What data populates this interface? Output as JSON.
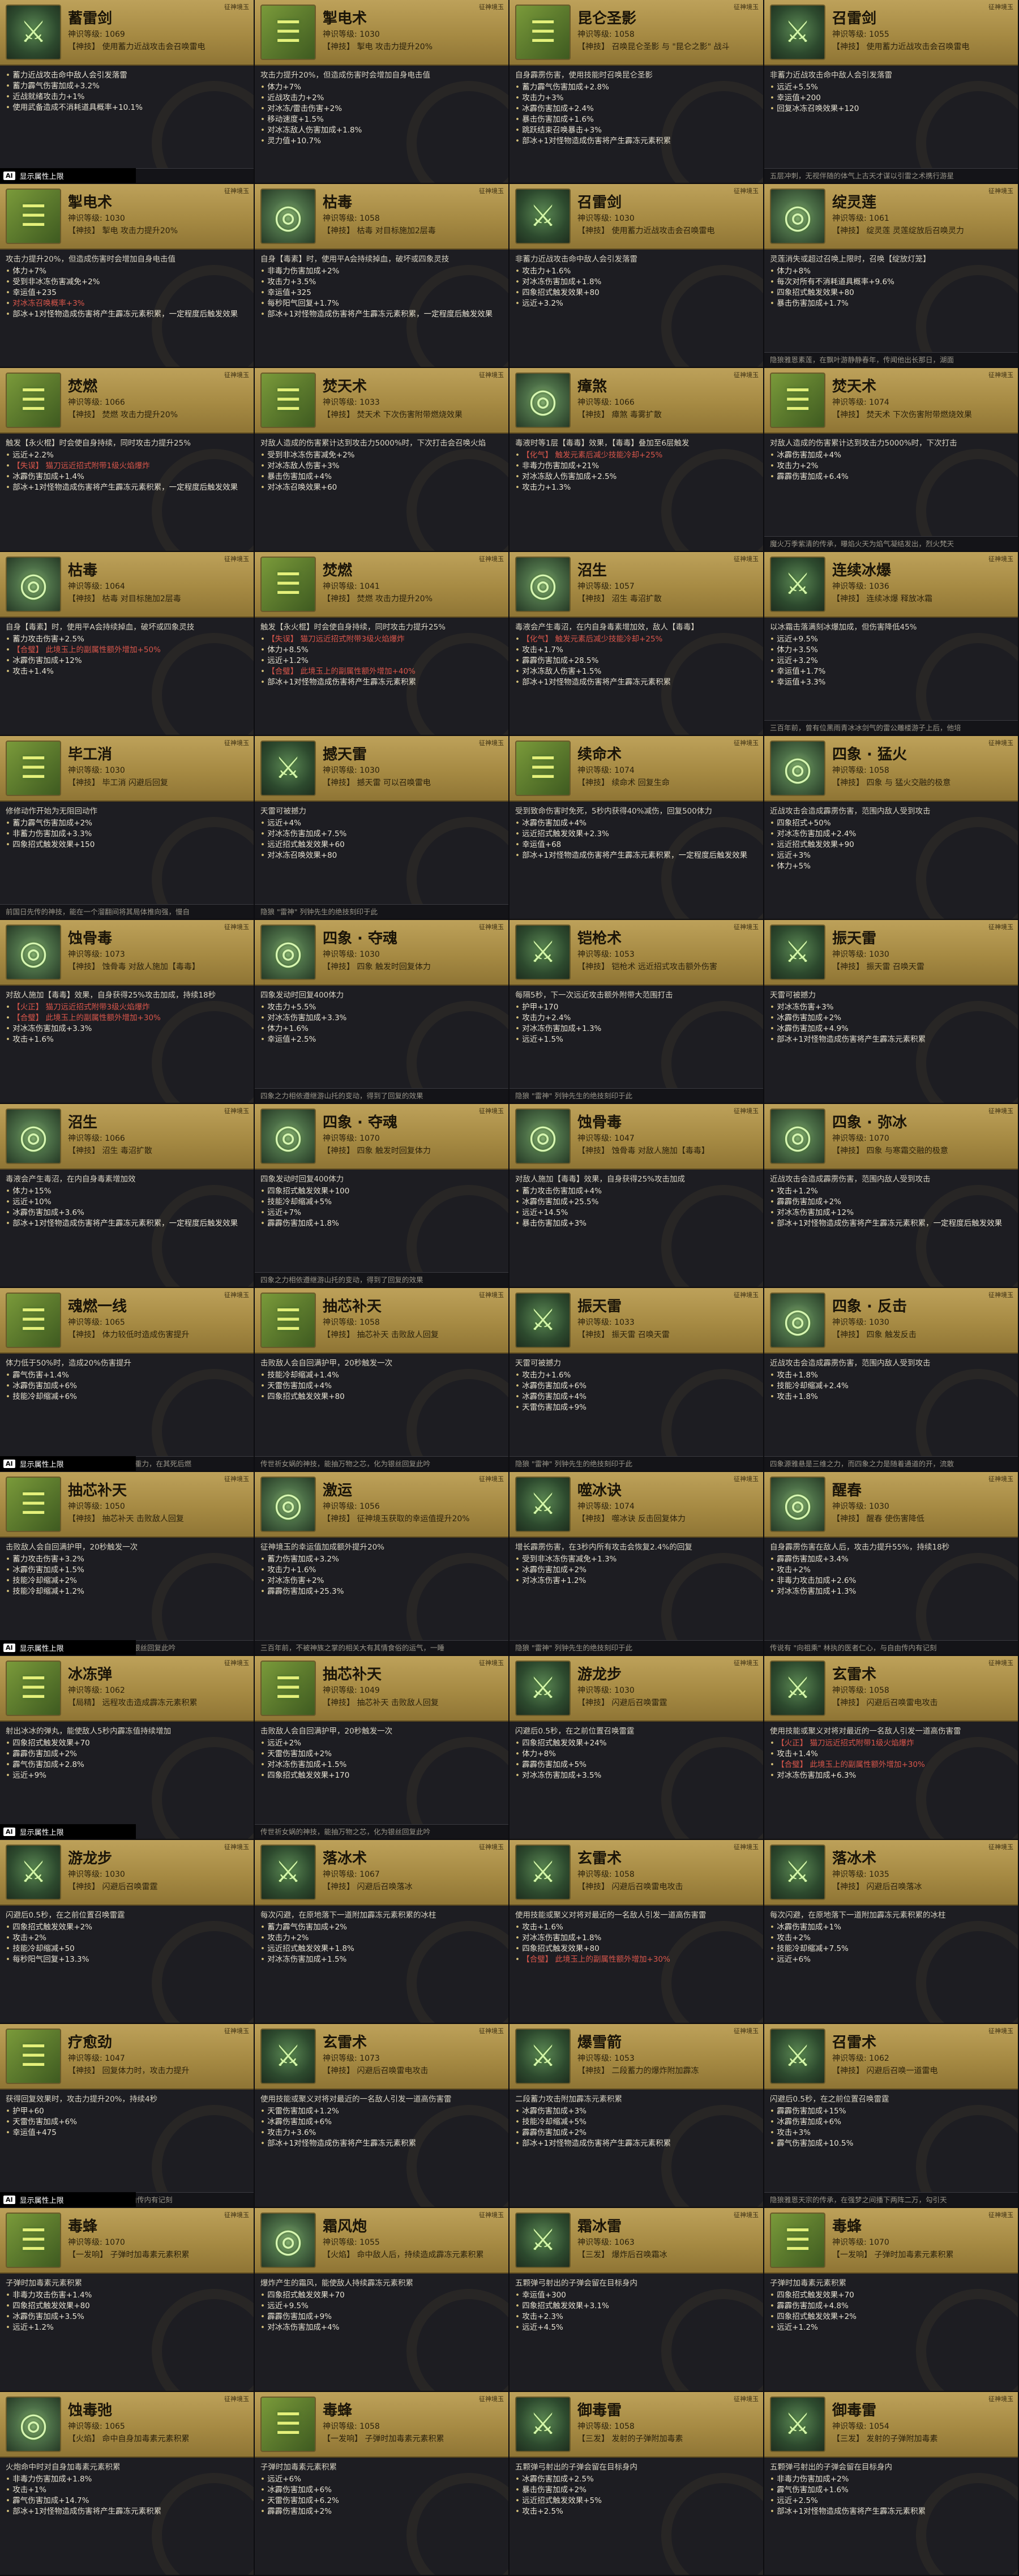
{
  "badge_label": "征神境玉",
  "ai_tag": "AI",
  "ai_text": "显示属性上限",
  "cards": [
    {
      "title": "蓄雷剑",
      "level": "神识等级: 1069",
      "effect": "【神技】 使用蓄力近战攻击会召唤雷电",
      "icon": "sword",
      "desc": "",
      "stats": [
        "蓄力近战攻击命中敌人会引发落雷",
        "蓄力霹气伤害加成+3.2%",
        "近战就绪攻击力+1%",
        "使用武备造成不消耗道具概率+10.1%"
      ],
      "foot": "隐狼 \"雷神\" 列钟先生的绝技刻印于此",
      "ai": true
    },
    {
      "title": "掣电术",
      "level": "神识等级: 1030",
      "effect": "【神技】 掣电 攻击力提升20%",
      "icon": "book",
      "desc": "攻击力提升20%，但造成伤害时会增加自身电击值",
      "stats": [
        "体力+7%",
        "近战攻击力+2%",
        "对冰冻/雷击伤害+2%",
        "移动速度+1.5%",
        "对冰冻敌人伤害加成+1.8%",
        "灵力值+10.7%"
      ],
      "foot": ""
    },
    {
      "title": "昆仑圣影",
      "level": "神识等级: 1058",
      "effect": "【神技】 召唤昆仑圣影 与 \"昆仑之影\" 战斗",
      "icon": "book",
      "desc": "自身霹雳伤害，使用技能时召唤昆仑圣影",
      "stats": [
        "蓄力霹气伤害加成+2.8%",
        "攻击力+3%",
        "冰霹伤害加成+2.4%",
        "暴击伤害加成+1.6%",
        "跳跃结束召唤暴击+3%",
        "部冰+1对怪物造成伤害将产生霹冻元素积累"
      ],
      "foot": ""
    },
    {
      "title": "召雷剑",
      "level": "神识等级: 1055",
      "effect": "【神技】 使用蓄力近战攻击会召唤雷电",
      "icon": "sword",
      "desc": "非蓄力近战攻击命中敌人会引发落雷",
      "stats": [
        "远近+5.5%",
        "幸运值+200",
        "回复冰冻召唤效果+120"
      ],
      "foot": "五层冲刺，无视伴随的体气上古天才谋以引雷之术携行游星"
    },
    {
      "title": "掣电术",
      "level": "神识等级: 1030",
      "effect": "【神技】 掣电 攻击力提升20%",
      "icon": "book",
      "desc": "攻击力提升20%，但造成伤害时会增加自身电击值",
      "stats": [
        "体力+7%",
        "受到非冰冻伤害减免+2%",
        "幸运值+235",
        "对冰冻召唤概率+3%",
        "部冰+1对怪物造成伤害将产生霹冻元素积累，一定程度后触发效果"
      ],
      "foot": "",
      "hl": [
        3
      ]
    },
    {
      "title": "枯毒",
      "level": "神识等级: 1058",
      "effect": "【神技】 枯毒 对目标施加2层毒",
      "icon": "disc",
      "desc": "自身【毒素】时，使用平A会持续掉血，破坏或四象灵技",
      "stats": [
        "非毒力伤害加成+2%",
        "攻击力+3.5%",
        "幸运值+325",
        "每秒阳气回复+1.7%",
        "部冰+1对怪物造成伤害将产生霹冻元素积累，一定程度后触发效果"
      ],
      "foot": ""
    },
    {
      "title": "召雷剑",
      "level": "神识等级: 1030",
      "effect": "【神技】 使用蓄力近战攻击会召唤雷电",
      "icon": "sword",
      "desc": "非蓄力近战攻击命中敌人会引发落雷",
      "stats": [
        "攻击力+1.6%",
        "对冰冻伤害加成+1.8%",
        "四象招式触发效果+80",
        "远近+3.2%"
      ],
      "foot": ""
    },
    {
      "title": "绽灵莲",
      "level": "神识等级: 1061",
      "effect": "【神技】 绽灵莲 灵莲绽放后召唤灵力",
      "icon": "disc",
      "desc": "灵莲消失或超过召唤上限时，召唤【绽放灯笼】",
      "stats": [
        "体力+8%",
        "每次对所有不消耗道具概率+9.6%",
        "四象招式触发效果+80",
        "暴击伤害加成+1.7%"
      ],
      "foot": "隐狼雅恩素莲，在飘叶游静静春年，传闻他出长那日，湖面"
    },
    {
      "title": "焚燃",
      "level": "神识等级: 1066",
      "effect": "【神技】 焚燃 攻击力提升20%",
      "icon": "book",
      "desc": "触发【永火棍】时会使自身持续，同时攻击力提升25%",
      "stats": [
        "远近+2.2%",
        "【失误】 猫刀远近招式附带1级火焰爆炸",
        "冰霹伤害加成+1.4%",
        "部冰+1对怪物造成伤害将产生霹冻元素积累，一定程度后触发效果"
      ],
      "foot": "",
      "hl": [
        1
      ]
    },
    {
      "title": "焚天术",
      "level": "神识等级: 1033",
      "effect": "【神技】 焚天术 下次伤害附带燃烧效果",
      "icon": "book",
      "desc": "对敌人造成的伤害累计达到攻击力5000%时，下次打击会召唤火焰",
      "stats": [
        "受到非冰冻伤害减免+2%",
        "对冰冻敌人伤害+3%",
        "暴击伤害加成+4%",
        "对冰冻召唤效果+60"
      ],
      "foot": ""
    },
    {
      "title": "瘴煞",
      "level": "神识等级: 1066",
      "effect": "【神技】 瘴煞 毒雾扩散",
      "icon": "disc",
      "desc": "毒液时等1层【毒毒】效果，【毒毒】叠加至6层触发",
      "stats": [
        "【化气】 触发元素后减少技能冷却+25%",
        "非毒力伤害加成+21%",
        "对冰冻敌人伤害加成+2.5%",
        "攻击力+1.3%"
      ],
      "foot": "",
      "hl": [
        0
      ]
    },
    {
      "title": "焚天术",
      "level": "神识等级: 1074",
      "effect": "【神技】 焚天术 下次伤害附带燃烧效果",
      "icon": "book",
      "desc": "对敌人造成的伤害累计达到攻击力5000%时，下次打击",
      "stats": [
        "冰霹伤害加成+4%",
        "攻击力+2%",
        "霹霹伤害加成+6.4%"
      ],
      "foot": "魔火万季紫清的传承，曝焰火天为焰气凝结发出，烈火梵天"
    },
    {
      "title": "枯毒",
      "level": "神识等级: 1064",
      "effect": "【神技】 枯毒 对目标施加2层毒",
      "icon": "disc",
      "desc": "自身【毒素】时，使用平A会持续掉血，破坏或四象灵技",
      "stats": [
        "蓄力攻击伤害+2.5%",
        "【合璧】 此境玉上的副属性额外增加+50%",
        "冰霹伤害加成+12%",
        "攻击+1.4%"
      ],
      "foot": "",
      "hl": [
        1
      ]
    },
    {
      "title": "焚燃",
      "level": "神识等级: 1041",
      "effect": "【神技】 焚燃 攻击力提升20%",
      "icon": "book",
      "desc": "触发【永火棍】时会使自身持续，同时攻击力提升25%",
      "stats": [
        "【失误】 猫刀远近招式附带3级火焰爆炸",
        "体力+8.5%",
        "远近+1.2%",
        "【合璧】 此境玉上的副属性额外增加+40%",
        "部冰+1对怪物造成伤害将产生霹冻元素积累"
      ],
      "foot": "",
      "hl": [
        0,
        3
      ]
    },
    {
      "title": "沼生",
      "level": "神识等级: 1057",
      "effect": "【神技】 沼生 毒沼扩散",
      "icon": "disc",
      "desc": "毒液会产生毒沼，在内自身毒素增加效，敌人【毒毒】",
      "stats": [
        "【化气】 触发元素后减少技能冷却+25%",
        "攻击+1.7%",
        "霹霹伤害加成+28.5%",
        "对冰冻敌人伤害+1.5%",
        "部冰+1对怪物造成伤害将产生霹冻元素积累"
      ],
      "foot": "",
      "hl": [
        0
      ]
    },
    {
      "title": "连续冰爆",
      "level": "神识等级: 1036",
      "effect": "【神技】 连续冰爆 释放冰霜",
      "icon": "sword",
      "desc": "以冰霜击落满刻冰爆加成，但伤害降低45%",
      "stats": [
        "远近+9.5%",
        "体力+3.5%",
        "远近+3.2%",
        "幸运值+1.7%",
        "幸运值+3.3%"
      ],
      "foot": "三百年前，曾有位黑雨青冰冰剑气的雷公雕楼游子上后，他培"
    },
    {
      "title": "毕工消",
      "level": "神识等级: 1030",
      "effect": "【神技】 毕工消 闪避后回复",
      "icon": "book",
      "desc": "修修动作开始为无阻回动作",
      "stats": [
        "蓄力霹气伤害加成+2%",
        "非蓄力伤害加成+3.3%",
        "四象招式触发效果+150"
      ],
      "foot": "前国日先传的神技，能在一个溜翻间将其局体推向强，慢自"
    },
    {
      "title": "撼天雷",
      "level": "神识等级: 1030",
      "effect": "【神技】 撼天雷 可以召唤雷电",
      "icon": "sword",
      "desc": "天雷可被撼力",
      "stats": [
        "远近+4%",
        "对冰冻伤害加成+7.5%",
        "远近招式触发效果+60",
        "对冰冻召唤效果+80"
      ],
      "foot": "隐狼 \"雷神\" 列钟先生的绝技刻印于此"
    },
    {
      "title": "续命术",
      "level": "神识等级: 1074",
      "effect": "【神技】 续命术 回复生命",
      "icon": "book",
      "desc": "受到致命伤害时免死，5秒内获得40%减伤，回复500体力",
      "stats": [
        "冰霹伤害加成+4%",
        "远近招式触发效果+2.3%",
        "幸运值+68",
        "部冰+1对怪物造成伤害将产生霹冻元素积累，一定程度后触发效果"
      ],
      "foot": ""
    },
    {
      "title": "四象 · 猛火",
      "level": "神识等级: 1058",
      "effect": "【神技】 四象 与 猛火交融的极意",
      "icon": "disc",
      "desc": "近战攻击会造成霹雳伤害，范围内敌人受到攻击",
      "stats": [
        "四象招式+50%",
        "对冰冻伤害加成+2.4%",
        "远近招式触发效果+90",
        "远近+3%",
        "体力+5%"
      ],
      "foot": ""
    },
    {
      "title": "蚀骨毒",
      "level": "神识等级: 1073",
      "effect": "【神技】 蚀骨毒 对敌人施加【毒毒】",
      "icon": "disc",
      "desc": "对敌人施加【毒毒】效果，自身获得25%攻击加成，持续18秒",
      "stats": [
        "【火正】 猫刀远近招式附带3级火焰爆炸",
        "【合璧】 此境玉上的副属性额外增加+30%",
        "对冰冻伤害加成+3.3%",
        "攻击+1.6%"
      ],
      "foot": "",
      "hl": [
        0,
        1
      ]
    },
    {
      "title": "四象 · 夺魂",
      "level": "神识等级: 1030",
      "effect": "【神技】 四象 触发时回复体力",
      "icon": "disc",
      "desc": "四象发动时回复400体力",
      "stats": [
        "攻击力+5.5%",
        "对冰冻伤害加成+3.3%",
        "体力+1.6%",
        "幸运值+2.5%"
      ],
      "foot": "四象之力相依遵继游山托的变动，得到了回复的效果"
    },
    {
      "title": "铠枪术",
      "level": "神识等级: 1053",
      "effect": "【神技】 铠枪术 远近招式攻击额外伤害",
      "icon": "sword",
      "desc": "每隔5秒，下一次远近攻击额外附带大范围打击",
      "stats": [
        "护甲+170",
        "攻击力+2.4%",
        "对冰冻伤害加成+1.3%",
        "远近+1.5%"
      ],
      "foot": "隐狼 \"雷神\" 列钟先生的绝技刻印于此"
    },
    {
      "title": "振天雷",
      "level": "神识等级: 1030",
      "effect": "【神技】 振天雷 召唤天雷",
      "icon": "sword",
      "desc": "天雷可被撼力",
      "stats": [
        "对冰冻伤害+3%",
        "冰霹伤害加成+2%",
        "冰霹伤害加成+4.9%",
        "部冰+1对怪物造成伤害将产生霹冻元素积累"
      ],
      "foot": ""
    },
    {
      "title": "沼生",
      "level": "神识等级: 1066",
      "effect": "【神技】 沼生 毒沼扩散",
      "icon": "disc",
      "desc": "毒液会产生毒沼，在内自身毒素增加效",
      "stats": [
        "体力+15%",
        "远近+10%",
        "冰霹伤害加成+3.6%",
        "部冰+1对怪物造成伤害将产生霹冻元素积累，一定程度后触发效果"
      ],
      "foot": ""
    },
    {
      "title": "四象 · 夺魂",
      "level": "神识等级: 1070",
      "effect": "【神技】 四象 触发时回复体力",
      "icon": "disc",
      "desc": "四象发动时回复400体力",
      "stats": [
        "四象招式触发效果+100",
        "技能冷却缩减+5%",
        "远近+7%",
        "霹霹伤害加成+1.8%"
      ],
      "foot": "四象之力相依遵继游山托的变动，得到了回复的效果"
    },
    {
      "title": "蚀骨毒",
      "level": "神识等级: 1047",
      "effect": "【神技】 蚀骨毒 对敌人施加【毒毒】",
      "icon": "disc",
      "desc": "对敌人施加【毒毒】效果，自身获得25%攻击加成",
      "stats": [
        "蓄力攻击伤害加成+4%",
        "冰霹伤害加成+25.5%",
        "远近+14.5%",
        "暴击伤害加成+3%"
      ],
      "foot": ""
    },
    {
      "title": "四象 · 弥冰",
      "level": "神识等级: 1070",
      "effect": "【神技】 四象 与寒霜交融的极意",
      "icon": "disc",
      "desc": "近战攻击会造成霹雳伤害，范围内敌人受到攻击",
      "stats": [
        "攻击+1.2%",
        "霹霹伤害加成+2%",
        "对冰冻伤害加成+12%",
        "部冰+1对怪物造成伤害将产生霹冻元素积累，一定程度后触发效果"
      ],
      "foot": ""
    },
    {
      "title": "魂燃一线",
      "level": "神识等级: 1065",
      "effect": "【神技】 体力较低时造成伤害提升",
      "icon": "book",
      "desc": "体力低于50%时，造成20%伤害提升",
      "stats": [
        "霹气伤害+1.4%",
        "冰霹伤害加成+6%",
        "技能冷却缩减+6%"
      ],
      "foot": "\"魂灵燃\" 据说，能医者一线能毅然按照的重力，在其死后燃",
      "ai": true
    },
    {
      "title": "抽芯补天",
      "level": "神识等级: 1058",
      "effect": "【神技】 抽芯补天 击败敌人回复",
      "icon": "book",
      "desc": "击败敌人会自回满护甲，20秒触发一次",
      "stats": [
        "技能冷却缩减+1.4%",
        "天雷伤害加成+4%",
        "四象招式触发效果+80"
      ],
      "foot": "传世祈女娲的神技，能抽万物之芯，化为银丝回复此吟"
    },
    {
      "title": "振天雷",
      "level": "神识等级: 1033",
      "effect": "【神技】 振天雷 召唤天雷",
      "icon": "sword",
      "desc": "天雷可被撼力",
      "stats": [
        "攻击力+1.6%",
        "冰霹伤害加成+6%",
        "冰霹伤害加成+4%",
        "天雷伤害加成+9%"
      ],
      "foot": "隐狼 \"雷神\" 列钟先生的绝技刻印于此"
    },
    {
      "title": "四象 · 反击",
      "level": "神识等级: 1030",
      "effect": "【神技】 四象 触发反击",
      "icon": "disc",
      "desc": "近战攻击会造成霹雳伤害，范围内敌人受到攻击",
      "stats": [
        "攻击+1.8%",
        "技能冷却缩减+2.4%",
        "攻击+1.8%"
      ],
      "foot": "四象源雅悬是三维之力，而四象之力是随着通道的开，流散"
    },
    {
      "title": "抽芯补天",
      "level": "神识等级: 1050",
      "effect": "【神技】 抽芯补天 击败敌人回复",
      "icon": "book",
      "desc": "击败敌人会自回满护甲，20秒触发一次",
      "stats": [
        "蓄力攻击伤害+3.2%",
        "冰霹伤害加成+1.5%",
        "技能冷却缩减+2%",
        "技能冷却缩减+1.2%"
      ],
      "foot": "传世祈女娲的神技，能抽万物之芯，化为银丝回复此吟",
      "ai": true
    },
    {
      "title": "激运",
      "level": "神识等级: 1056",
      "effect": "【神技】 征神境玉获取的幸运值提升20%",
      "icon": "disc",
      "desc": "征神境玉的幸运值加成额外提升20%",
      "stats": [
        "蓄力伤害加成+3.2%",
        "攻击力+1.6%",
        "对冰冻伤害+2%",
        "霹霹伤害加成+25.3%"
      ],
      "foot": "三百年前，不被神族之掌的相关大有其情食俗的运气，一睡"
    },
    {
      "title": "噬冰诀",
      "level": "神识等级: 1074",
      "effect": "【神技】 噬冰诀 反击回复体力",
      "icon": "sword",
      "desc": "增长霹雳伤害，在3秒内所有攻击会恢复2.4%的回复",
      "stats": [
        "受到非冰冻伤害减免+1.3%",
        "冰霹伤害加成+2%",
        "对冰冻伤害+1.2%"
      ],
      "foot": "隐狼 \"雷神\" 列钟先生的绝技刻印于此"
    },
    {
      "title": "醒春",
      "level": "神识等级: 1030",
      "effect": "【神技】 醒春 使伤害降低",
      "icon": "disc",
      "desc": "自身霹雳伤害在敌人后，攻击力提升55%，持续18秒",
      "stats": [
        "霹霹伤害加成+3.4%",
        "攻击+2%",
        "非毒力攻击加成+2.6%",
        "对冰冻伤害加成+1.3%"
      ],
      "foot": "传说有 \"向祖乘\" 林执的医者仁心，与自由传内有记刻"
    },
    {
      "title": "冰冻弹",
      "level": "神识等级: 1062",
      "effect": "【局精】 远程攻击造成霹冻元素积累",
      "icon": "book",
      "desc": "射出冰冰的弹丸，能使敌人5秒内霹冻值持续增加",
      "stats": [
        "四象招式触发效果+70",
        "霹霹伤害加成+2%",
        "霹气伤害加成+2.8%",
        "远近+9%"
      ],
      "foot": "",
      "ai": true
    },
    {
      "title": "抽芯补天",
      "level": "神识等级: 1049",
      "effect": "【神技】 抽芯补天 击败敌人回复",
      "icon": "book",
      "desc": "击败敌人会自回满护甲，20秒触发一次",
      "stats": [
        "远近+2%",
        "天雷伤害加成+2%",
        "对冰冻伤害加成+1.5%",
        "四象招式触发效果+170"
      ],
      "foot": "传世祈女娲的神技，能抽万物之芯，化为银丝回复此吟"
    },
    {
      "title": "游龙步",
      "level": "神识等级: 1030",
      "effect": "【神技】 闪避后召唤雷霆",
      "icon": "sword",
      "desc": "闪避后0.5秒，在之前位置召唤雷霆",
      "stats": [
        "四象招式触发效果+24%",
        "体力+8%",
        "霹霹伤害加成+5%",
        "对冰冻伤害加成+3.5%"
      ],
      "foot": ""
    },
    {
      "title": "玄雷术",
      "level": "神识等级: 1058",
      "effect": "【神技】 闪避后召唤雷电攻击",
      "icon": "sword",
      "desc": "使用技能或聚义对将对最近的一名敌人引发一道高伤害雷",
      "stats": [
        "【火正】 猫刀远近招式附带1级火焰爆炸",
        "攻击+1.4%",
        "【合璧】 此境玉上的副属性额外增加+30%",
        "对冰冻伤害加成+6.3%"
      ],
      "foot": "",
      "hl": [
        0,
        2
      ]
    },
    {
      "title": "游龙步",
      "level": "神识等级: 1030",
      "effect": "【神技】 闪避后召唤雷霆",
      "icon": "sword",
      "desc": "闪避后0.5秒，在之前位置召唤雷霆",
      "stats": [
        "四象招式触发效果+2%",
        "攻击+2%",
        "技能冷却缩减+50",
        "每秒阳气回复+13.3%"
      ],
      "foot": ""
    },
    {
      "title": "落冰术",
      "level": "神识等级: 1067",
      "effect": "【神技】 闪避后召唤落冰",
      "icon": "sword",
      "desc": "每次闪避，在原地落下一道附加霹冻元素积累的冰柱",
      "stats": [
        "蓄力霹气伤害加成+2%",
        "攻击力+2%",
        "远近招式触发效果+1.8%",
        "对冰冻伤害加成+1.5%"
      ],
      "foot": ""
    },
    {
      "title": "玄雷术",
      "level": "神识等级: 1058",
      "effect": "【神技】 闪避后召唤雷电攻击",
      "icon": "sword",
      "desc": "使用技能或聚义对将对最近的一名敌人引发一道高伤害雷",
      "stats": [
        "攻击+1.6%",
        "对冰冻伤害加成+1.8%",
        "四象招式触发效果+80",
        "【合璧】 此境玉上的副属性额外增加+30%"
      ],
      "foot": "",
      "hl": [
        3
      ]
    },
    {
      "title": "落冰术",
      "level": "神识等级: 1035",
      "effect": "【神技】 闪避后召唤落冰",
      "icon": "sword",
      "desc": "每次闪避，在原地落下一道附加霹冻元素积累的冰柱",
      "stats": [
        "冰霹伤害加成+1%",
        "攻击+2%",
        "技能冷却缩减+7.5%",
        "远近+6%"
      ],
      "foot": ""
    },
    {
      "title": "疗愈劲",
      "level": "神识等级: 1047",
      "effect": "【神技】 回复体力时，攻击力提升",
      "icon": "book",
      "desc": "获得回复效果时，攻击力提升20%，持续4秒",
      "stats": [
        "护甲+60",
        "天雷伤害加成+6%",
        "幸运值+475"
      ],
      "foot": "刘存春 \"向祖乘\" 林执的医者仁心，与自由传内有记刻",
      "ai": true
    },
    {
      "title": "玄雷术",
      "level": "神识等级: 1073",
      "effect": "【神技】 闪避后召唤雷电攻击",
      "icon": "sword",
      "desc": "使用技能或聚义对将对最近的一名敌人引发一道高伤害雷",
      "stats": [
        "天雷伤害加成+1.2%",
        "冰霹伤害加成+6%",
        "攻击力+3.6%",
        "部冰+1对怪物造成伤害将产生霹冻元素积累"
      ],
      "foot": ""
    },
    {
      "title": "爆雪箭",
      "level": "神识等级: 1053",
      "effect": "【神技】 二段蓄力的爆炸附加霹冻",
      "icon": "sword",
      "desc": "二段蓄力攻击附加霹冻元素积累",
      "stats": [
        "冰霹伤害加成+3%",
        "技能冷却缩减+5%",
        "霹霹伤害加成+2%",
        "部冰+1对怪物造成伤害将产生霹冻元素积累"
      ],
      "foot": ""
    },
    {
      "title": "召雷术",
      "level": "神识等级: 1062",
      "effect": "【神技】 闪避后召唤一道雷电",
      "icon": "sword",
      "desc": "闪避后0.5秒，在之前位置召唤雷霆",
      "stats": [
        "霹霹伤害加成+15%",
        "冰霹伤害加成+6%",
        "攻击+3%",
        "霹气伤害加成+10.5%"
      ],
      "foot": "隐狼雅恩天宗的传承，在强梦之间播下两阵二万，勾引天"
    },
    {
      "title": "毒蜂",
      "level": "神识等级: 1070",
      "effect": "【一发响】 子弹时加毒素元素积累",
      "icon": "book",
      "desc": "子弹时加毒素元素积累",
      "stats": [
        "非毒力攻击伤害+1.4%",
        "四象招式触发效果+80",
        "冰霹伤害加成+3.5%",
        "远近+1.2%"
      ],
      "foot": ""
    },
    {
      "title": "霜风炮",
      "level": "神识等级: 1055",
      "effect": "【火焰】 命中敌人后，持续造成霹冻元素积累",
      "icon": "disc",
      "desc": "爆炸产生的霜风，能使敌人持续霹冻元素积累",
      "stats": [
        "四象招式触发效果+70",
        "远近+9.5%",
        "霹霹伤害加成+9%",
        "对冰冻伤害加成+4%"
      ],
      "foot": ""
    },
    {
      "title": "霜冰雷",
      "level": "神识等级: 1063",
      "effect": "【三发】 爆炸后召唤霜冰",
      "icon": "sword",
      "desc": "五颗弹弓射出的子弹会留在目标身内",
      "stats": [
        "幸运值+300",
        "四象招式触发效果+3.1%",
        "攻击+2.3%",
        "远近+4.5%"
      ],
      "foot": ""
    },
    {
      "title": "毒蜂",
      "level": "神识等级: 1070",
      "effect": "【一发响】 子弹时加毒素元素积累",
      "icon": "book",
      "desc": "子弹时加毒素元素积累",
      "stats": [
        "四象招式触发效果+70",
        "霹霹伤害加成+4.8%",
        "四象招式触发效果+2%",
        "远近+1.2%"
      ],
      "foot": ""
    },
    {
      "title": "蚀毒弛",
      "level": "神识等级: 1065",
      "effect": "【火焰】 命中自身加毒素元素积累",
      "icon": "disc",
      "desc": "火炮命中时对自身加毒素元素积累",
      "stats": [
        "非毒力伤害加成+1.8%",
        "攻击+1%",
        "霹气伤害加成+14.7%",
        "部冰+1对怪物造成伤害将产生霹冻元素积累"
      ],
      "foot": ""
    },
    {
      "title": "毒蜂",
      "level": "神识等级: 1058",
      "effect": "【一发响】 子弹时加毒素元素积累",
      "icon": "book",
      "desc": "子弹时加毒素元素积累",
      "stats": [
        "远近+6%",
        "冰霹伤害加成+6%",
        "天雷伤害加成+6.2%",
        "霹霹伤害加成+2%"
      ],
      "foot": ""
    },
    {
      "title": "御毒雷",
      "level": "神识等级: 1058",
      "effect": "【三发】 发射的子弹附加毒素",
      "icon": "sword",
      "desc": "五颗弹弓射出的子弹会留在目标身内",
      "stats": [
        "冰霹伤害加成+2.5%",
        "暴击伤害加成+2%",
        "远近招式触发效果+5%",
        "攻击+2.5%"
      ],
      "foot": ""
    },
    {
      "title": "御毒雷",
      "level": "神识等级: 1054",
      "effect": "【三发】 发射的子弹附加毒素",
      "icon": "sword",
      "desc": "五颗弹弓射出的子弹会留在目标身内",
      "stats": [
        "非毒力伤害加成+2%",
        "霹气伤害加成+1.6%",
        "远近+2.5%",
        "部冰+1对怪物造成伤害将产生霹冻元素积累"
      ],
      "foot": ""
    }
  ]
}
